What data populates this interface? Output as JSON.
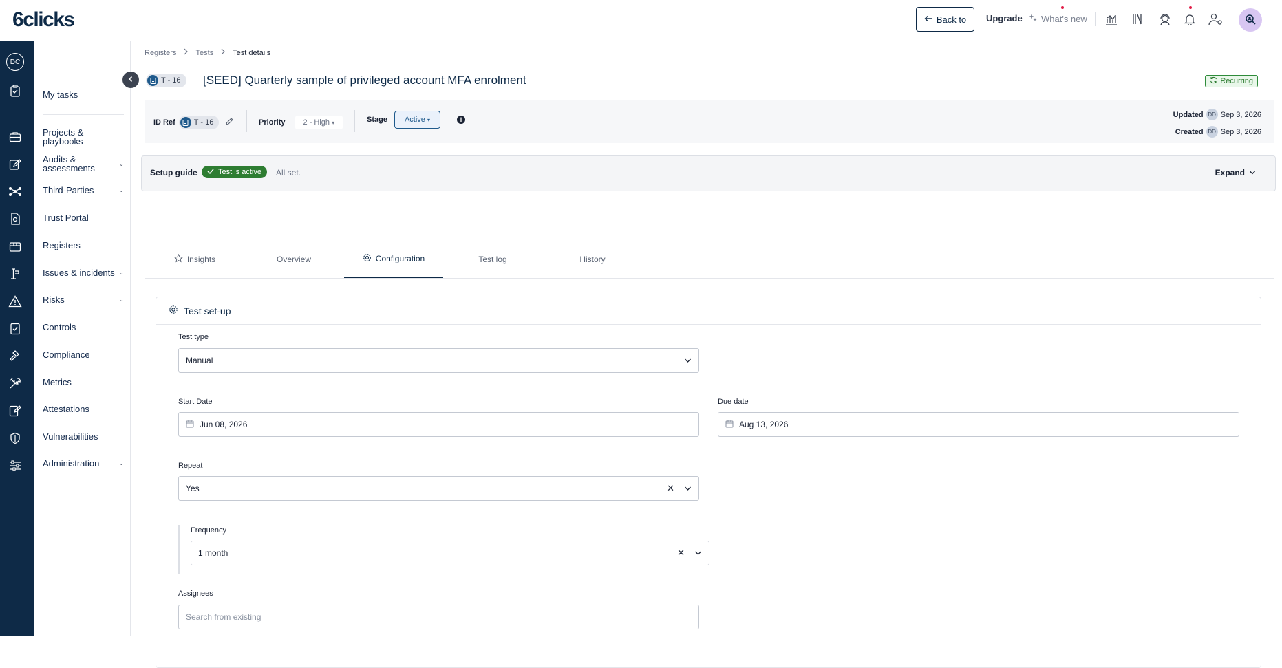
{
  "brand": {
    "logo": "6clicks"
  },
  "topbar": {
    "back_label": "Back to",
    "upgrade_label": "Upgrade",
    "whats_new_label": "What's new"
  },
  "rail": {
    "user_initials": "DC"
  },
  "sidebar": {
    "items": [
      {
        "label": "My tasks",
        "chevron": false
      },
      {
        "label": "Projects & playbooks",
        "chevron": false
      },
      {
        "label": "Audits & assessments",
        "chevron": true
      },
      {
        "label": "Third-Parties",
        "chevron": true
      },
      {
        "label": "Trust Portal",
        "chevron": false
      },
      {
        "label": "Registers",
        "chevron": false
      },
      {
        "label": "Issues & incidents",
        "chevron": true
      },
      {
        "label": "Risks",
        "chevron": true
      },
      {
        "label": "Controls",
        "chevron": false
      },
      {
        "label": "Compliance",
        "chevron": false
      },
      {
        "label": "Metrics",
        "chevron": false
      },
      {
        "label": "Attestations",
        "chevron": false
      },
      {
        "label": "Vulnerabilities",
        "chevron": false
      },
      {
        "label": "Administration",
        "chevron": true
      }
    ]
  },
  "breadcrumb": {
    "items": [
      "Registers",
      "Tests",
      "Test details"
    ]
  },
  "header": {
    "id_chip": "T - 16",
    "title": "[SEED] Quarterly sample of privileged account MFA enrolment",
    "recurring_label": "Recurring"
  },
  "infobar": {
    "id_ref_label": "ID Ref",
    "id_ref_value": "T - 16",
    "priority_label": "Priority",
    "priority_value": "2 - High",
    "stage_label": "Stage",
    "stage_value": "Active",
    "updated_label": "Updated",
    "updated_initials": "DD",
    "updated_date": "Sep 3, 2026",
    "created_label": "Created",
    "created_initials": "DD",
    "created_date": "Sep 3, 2026"
  },
  "setup_guide": {
    "label": "Setup guide",
    "badge": "Test is active",
    "status": "All set.",
    "expand_label": "Expand"
  },
  "tabs": [
    {
      "label": "Insights",
      "active": false
    },
    {
      "label": "Overview",
      "active": false
    },
    {
      "label": "Configuration",
      "active": true
    },
    {
      "label": "Test log",
      "active": false
    },
    {
      "label": "History",
      "active": false
    }
  ],
  "panel": {
    "title": "Test set-up",
    "test_type": {
      "label": "Test type",
      "value": "Manual"
    },
    "start_date": {
      "label": "Start Date",
      "value": "Jun 08, 2026"
    },
    "due_date": {
      "label": "Due date",
      "value": "Aug 13, 2026"
    },
    "repeat": {
      "label": "Repeat",
      "value": "Yes"
    },
    "frequency": {
      "label": "Frequency",
      "value": "1 month"
    },
    "assignees": {
      "label": "Assignees",
      "placeholder": "Search from existing"
    }
  },
  "colors": {
    "brand_navy": "#0e2a47",
    "active_green": "#2e7d32",
    "notification_red": "#e11d48"
  }
}
